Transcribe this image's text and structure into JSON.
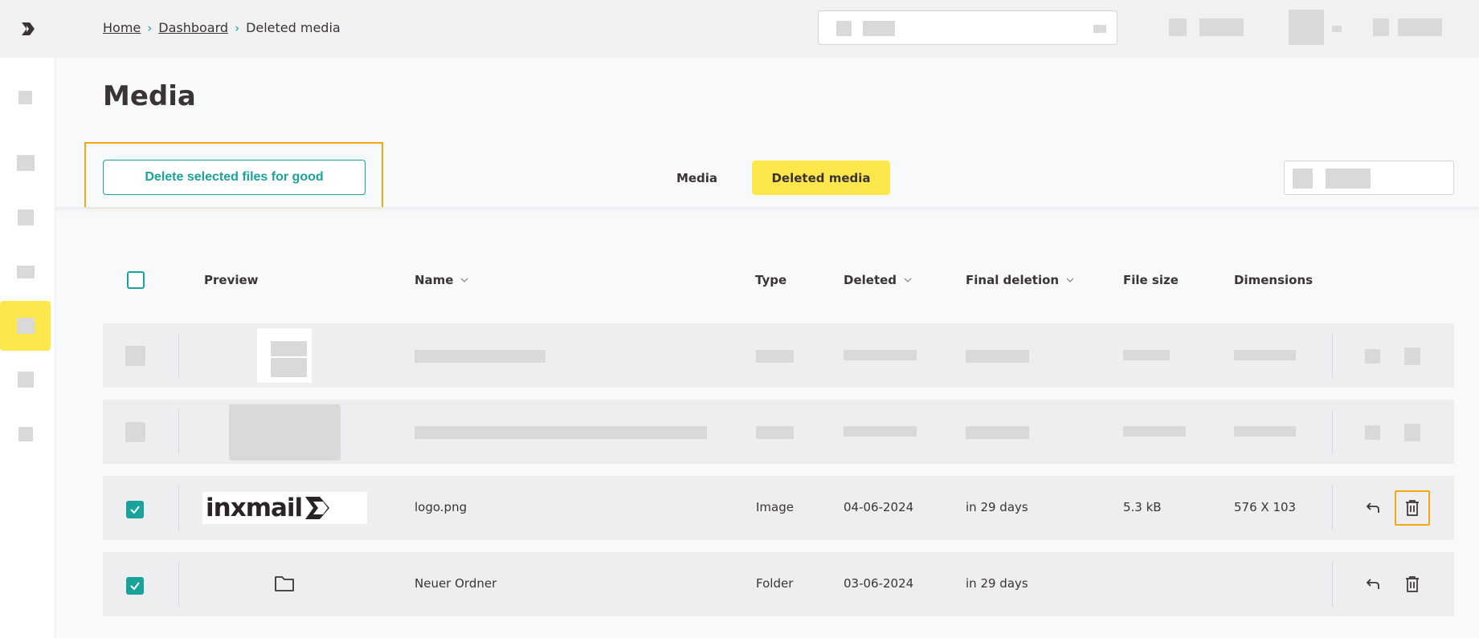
{
  "breadcrumb": {
    "home": "Home",
    "dashboard": "Dashboard",
    "current": "Deleted media"
  },
  "page": {
    "title": "Media"
  },
  "toolbar": {
    "delete_label": "Delete selected files for good",
    "tab_media": "Media",
    "tab_deleted": "Deleted media"
  },
  "table": {
    "headers": {
      "preview": "Preview",
      "name": "Name",
      "type": "Type",
      "deleted": "Deleted",
      "final_deletion": "Final deletion",
      "file_size": "File size",
      "dimensions": "Dimensions"
    },
    "rows": [
      {
        "name": "logo.png",
        "type": "Image",
        "deleted": "04-06-2024",
        "final_deletion": "in 29 days",
        "file_size": "5.3 kB",
        "dimensions": "576 X 103",
        "preview_text": "inxmail"
      },
      {
        "name": "Neuer Ordner",
        "type": "Folder",
        "deleted": "03-06-2024",
        "final_deletion": "in 29 days",
        "file_size": "",
        "dimensions": ""
      }
    ]
  },
  "icons": {
    "restore": "undo-arrow-icon",
    "delete": "trash-icon",
    "folder": "folder-icon",
    "brand": "inxmail-logo-icon"
  },
  "colors": {
    "accent": "#19a39b",
    "highlight": "#fde74c",
    "focus_outline": "#f3a712"
  }
}
